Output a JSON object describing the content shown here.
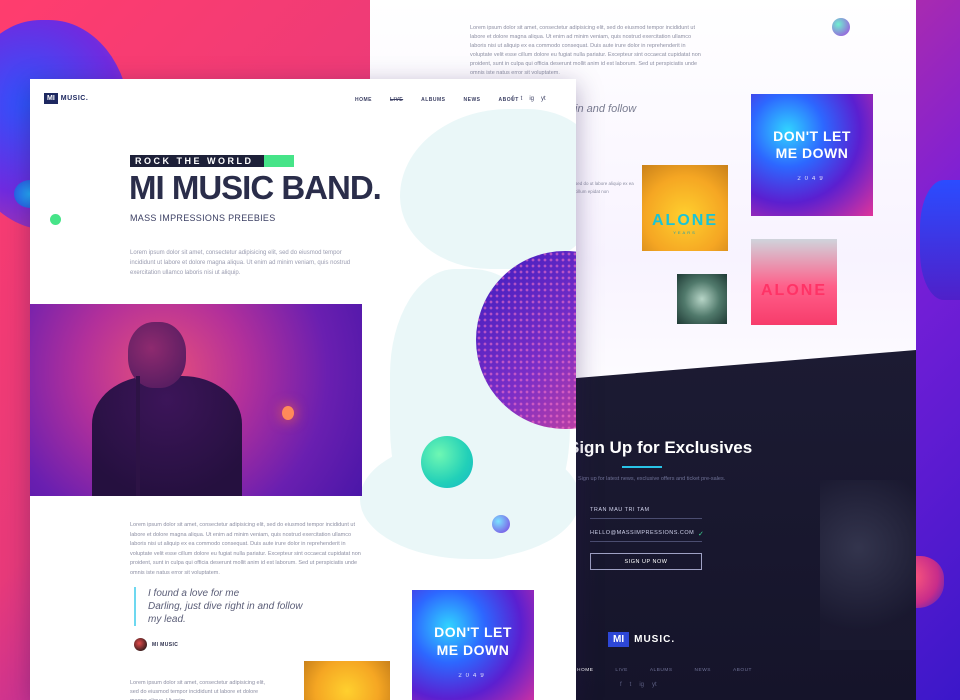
{
  "back_page": {
    "lorem": "Lorem ipsum dolor sit amet, consectetur adipisicing elit, sed do eiusmod tempor incididunt ut labore et dolore magna aliqua. Ut enim ad minim veniam, quis nostrud exercitation ullamco laboris nisi ut aliquip ex ea commodo consequat. Duis aute irure dolor in reprehenderit in voluptate velit esse cillum dolore eu fugiat nulla pariatur. Excepteur sint occaecat cupidatat non proident, sunt in culpa qui officia deserunt mollit anim id est laborum. Sed ut perspiciatis unde omnis iste natus error sit voluptatem.",
    "quote_fragment": "in and follow",
    "side_lorem": "sed do ut labore aliquip ex ea cillum epidat non",
    "albums": [
      {
        "title": "DON'T LET ME DOWN",
        "year": "2049"
      },
      {
        "title": "ALONE",
        "sub": "YEARS"
      },
      {
        "title": "ALONE"
      }
    ]
  },
  "signup": {
    "title": "Sign Up for Exclusives",
    "subtitle": "Sign up for latest news, exclusive offers and ticket pre-sales.",
    "name_field": "TRAN MAU TRI TAM",
    "email_field": "HELLO@MASSIMPRESSIONS.COM",
    "button": "SIGN UP NOW"
  },
  "footer": {
    "logo_box": "MI",
    "logo_word": "MUSIC.",
    "nav": [
      "HOME",
      "LIVE",
      "ALBUMS",
      "NEWS",
      "ABOUT"
    ],
    "social": [
      "f",
      "t",
      "ig",
      "yt"
    ]
  },
  "front_page": {
    "logo_box": "MI",
    "logo_word": "MUSIC.",
    "nav": [
      "HOME",
      "LIVE",
      "ALBUMS",
      "NEWS",
      "ABOUT"
    ],
    "social": [
      "f",
      "t",
      "ig",
      "yt"
    ],
    "kicker": "ROCK THE WORLD",
    "title": "MI MUSIC BAND.",
    "subtitle": "MASS IMPRESSIONS PREEBIES",
    "hero_lorem": "Lorem ipsum dolor sit amet, consectetur adipisicing elit, sed do eiusmod tempor incididunt ut labore et dolore magna aliqua. Ut enim ad minim veniam, quis nostrud exercitation ullamco laboris nisi ut aliquip.",
    "body_lorem": "Lorem ipsum dolor sit amet, consectetur adipisicing elit, sed do eiusmod tempor incididunt ut labore et dolore magna aliqua. Ut enim ad minim veniam, quis nostrud exercitation ullamco laboris nisi ut aliquip ex ea commodo consequat. Duis aute irure dolor in reprehenderit in voluptate velit esse cillum dolore eu fugiat nulla pariatur. Excepteur sint occaecat cupidatat non proident, sunt in culpa qui officia deserunt mollit anim id est laborum. Sed ut perspiciatis unde omnis iste natus error sit voluptatem.",
    "quote_line1": "I found a love for me",
    "quote_line2": "Darling, just dive right in and follow",
    "quote_line3": "my lead.",
    "author": "MI MUSIC",
    "album": {
      "title": "DON'T LET ME DOWN",
      "year": "2049"
    },
    "foot_lorem": "Lorem ipsum dolor sit amet, consectetur adipisicing elit, sed do eiusmod tempor incididunt ut labore et dolore magna aliqua. Ut enim"
  },
  "colors": {
    "navy": "#1d2860",
    "accent_green": "#46e488",
    "accent_cyan": "#29c3e6",
    "dark_bg": "#1c1b33"
  }
}
